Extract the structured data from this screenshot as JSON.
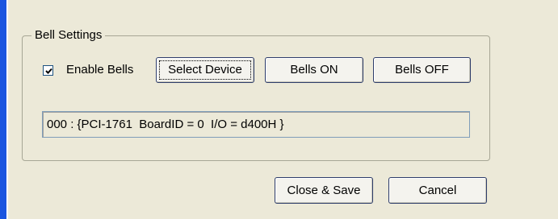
{
  "group": {
    "title": "Bell Settings"
  },
  "enable_bells": {
    "label": "Enable Bells",
    "checked": true
  },
  "buttons": {
    "select_device": "Select Device",
    "bells_on": "Bells ON",
    "bells_off": "Bells OFF",
    "close_save": "Close & Save",
    "cancel": "Cancel"
  },
  "device_field": {
    "value": "000 : {PCI-1761  BoardID = 0  I/O = d400H }"
  },
  "colors": {
    "window_bg": "#ece9d8",
    "frame_accent": "#1a55e0",
    "button_border": "#2e3d6b",
    "field_border": "#7f9db9"
  }
}
